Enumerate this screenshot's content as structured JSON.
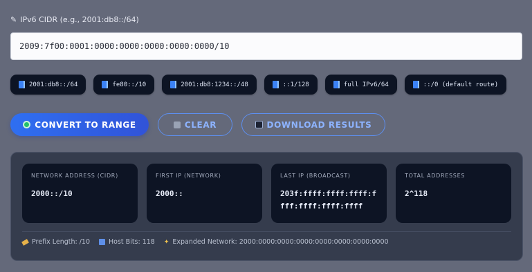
{
  "form": {
    "label": "IPv6 CIDR (e.g., 2001:db8::/64)",
    "input_value": "2009:7f00:0001:0000:0000:0000:0000:0000/10"
  },
  "presets": [
    {
      "label": "2001:db8::/64"
    },
    {
      "label": "fe80::/10"
    },
    {
      "label": "2001:db8:1234::/48"
    },
    {
      "label": "::1/128"
    },
    {
      "label": "full IPv6/64"
    },
    {
      "label": "::/0 (default route)"
    }
  ],
  "actions": {
    "convert": "CONVERT TO RANGE",
    "clear": "CLEAR",
    "download": "DOWNLOAD RESULTS"
  },
  "results": {
    "network_title": "NETWORK ADDRESS (CIDR)",
    "network_value": "2000::/10",
    "first_title": "FIRST IP (NETWORK)",
    "first_value": "2000::",
    "last_title": "LAST IP (BROADCAST)",
    "last_value": "203f:ffff:ffff:ffff:ffff:ffff:ffff:ffff",
    "total_title": "TOTAL ADDRESSES",
    "total_value": "2^118"
  },
  "footer": {
    "prefix": "Prefix Length: /10",
    "host_bits": "Host Bits: 118",
    "expanded": "Expanded Network: 2000:0000:0000:0000:0000:0000:0000:0000"
  }
}
